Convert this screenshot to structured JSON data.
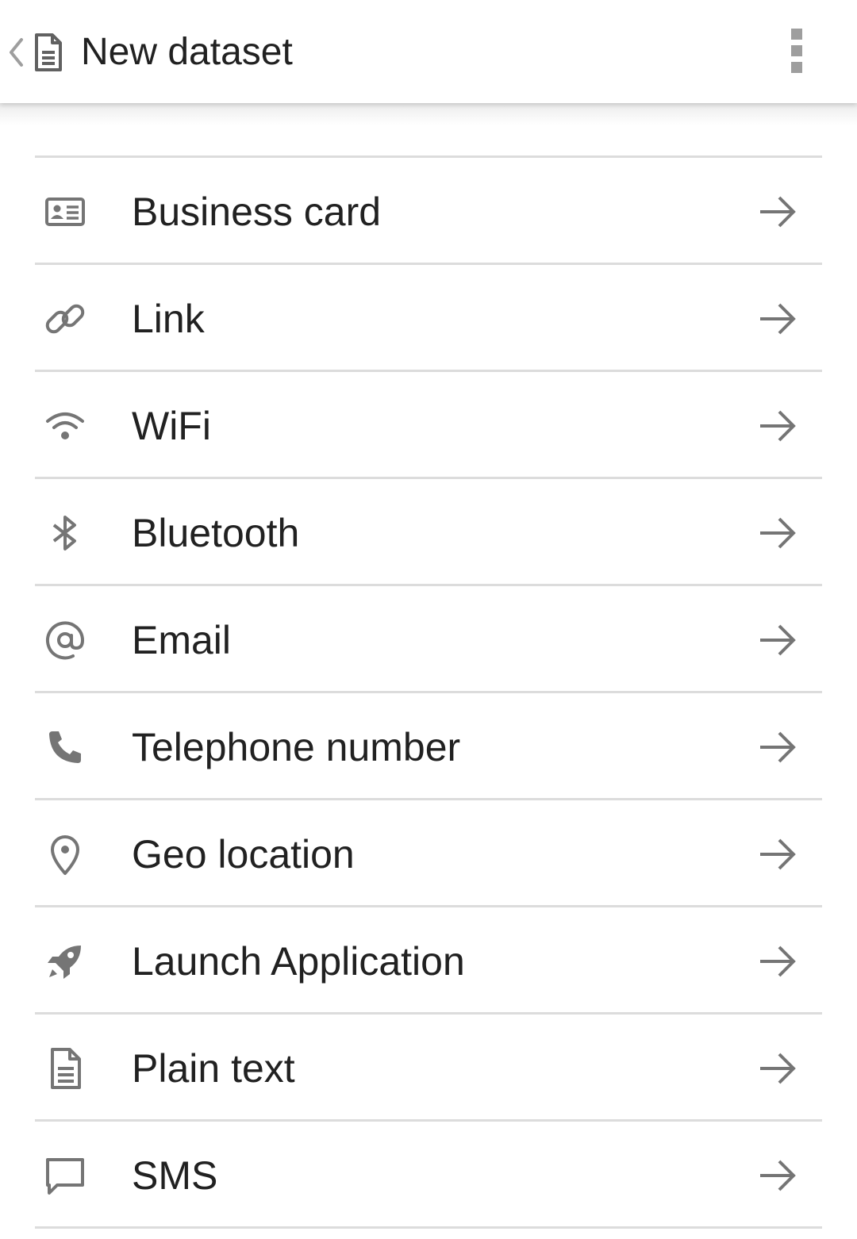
{
  "appbar": {
    "title": "New dataset",
    "back_icon": "chevron-left-icon",
    "title_icon": "document-icon",
    "menu_icon": "more-vert-icon"
  },
  "colors": {
    "icon_gray": "#757575",
    "text": "#212121",
    "divider": "#dcdcdc"
  },
  "items": [
    {
      "label": "Business card",
      "icon": "business-card-icon"
    },
    {
      "label": "Link",
      "icon": "link-icon"
    },
    {
      "label": "WiFi",
      "icon": "wifi-icon"
    },
    {
      "label": "Bluetooth",
      "icon": "bluetooth-icon"
    },
    {
      "label": "Email",
      "icon": "email-at-icon"
    },
    {
      "label": "Telephone number",
      "icon": "phone-icon"
    },
    {
      "label": "Geo location",
      "icon": "location-pin-icon"
    },
    {
      "label": "Launch Application",
      "icon": "rocket-icon"
    },
    {
      "label": "Plain text",
      "icon": "document-icon"
    },
    {
      "label": "SMS",
      "icon": "chat-bubble-icon"
    }
  ]
}
